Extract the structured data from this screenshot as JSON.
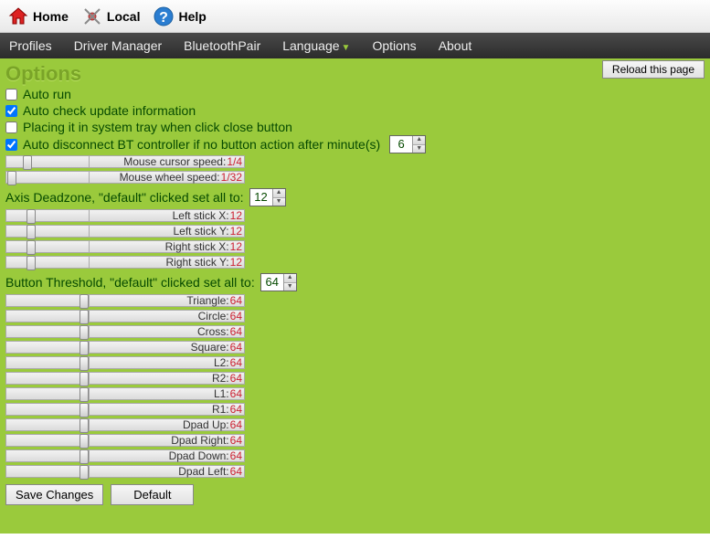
{
  "toolbar": {
    "home": "Home",
    "local": "Local",
    "help": "Help"
  },
  "menu": {
    "profiles": "Profiles",
    "driver_manager": "Driver Manager",
    "bluetooth_pair": "BluetoothPair",
    "language": "Language",
    "options": "Options",
    "about": "About"
  },
  "reload": "Reload this page",
  "title": "Options",
  "checks": {
    "auto_run": {
      "label": "Auto run",
      "checked": false
    },
    "auto_check": {
      "label": "Auto check update information",
      "checked": true
    },
    "systray": {
      "label": "Placing it in system tray when click close button",
      "checked": false
    },
    "auto_disc": {
      "label": "Auto disconnect BT controller if no button action after minute(s)",
      "checked": true,
      "value": "6"
    }
  },
  "mouse": {
    "cursor": {
      "label": "Mouse cursor speed:",
      "value": "1/4",
      "pos": 18
    },
    "wheel": {
      "label": "Mouse wheel speed:",
      "value": "1/32",
      "pos": 1
    }
  },
  "deadzone": {
    "title": "Axis Deadzone, \"default\" clicked set all to:",
    "value": "12",
    "items": [
      {
        "label": "Left stick X:",
        "value": "12",
        "pos": 22
      },
      {
        "label": "Left stick Y:",
        "value": "12",
        "pos": 22
      },
      {
        "label": "Right stick X:",
        "value": "12",
        "pos": 22
      },
      {
        "label": "Right stick Y:",
        "value": "12",
        "pos": 22
      }
    ]
  },
  "threshold": {
    "title": "Button Threshold, \"default\" clicked set all to:",
    "value": "64",
    "items": [
      {
        "label": "Triangle:",
        "value": "64",
        "pos": 80
      },
      {
        "label": "Circle:",
        "value": "64",
        "pos": 80
      },
      {
        "label": "Cross:",
        "value": "64",
        "pos": 80
      },
      {
        "label": "Square:",
        "value": "64",
        "pos": 80
      },
      {
        "label": "L2:",
        "value": "64",
        "pos": 80
      },
      {
        "label": "R2:",
        "value": "64",
        "pos": 80
      },
      {
        "label": "L1:",
        "value": "64",
        "pos": 80
      },
      {
        "label": "R1:",
        "value": "64",
        "pos": 80
      },
      {
        "label": "Dpad Up:",
        "value": "64",
        "pos": 80
      },
      {
        "label": "Dpad Right:",
        "value": "64",
        "pos": 80
      },
      {
        "label": "Dpad Down:",
        "value": "64",
        "pos": 80
      },
      {
        "label": "Dpad Left:",
        "value": "64",
        "pos": 80
      }
    ]
  },
  "buttons": {
    "save": "Save Changes",
    "default": "Default"
  }
}
